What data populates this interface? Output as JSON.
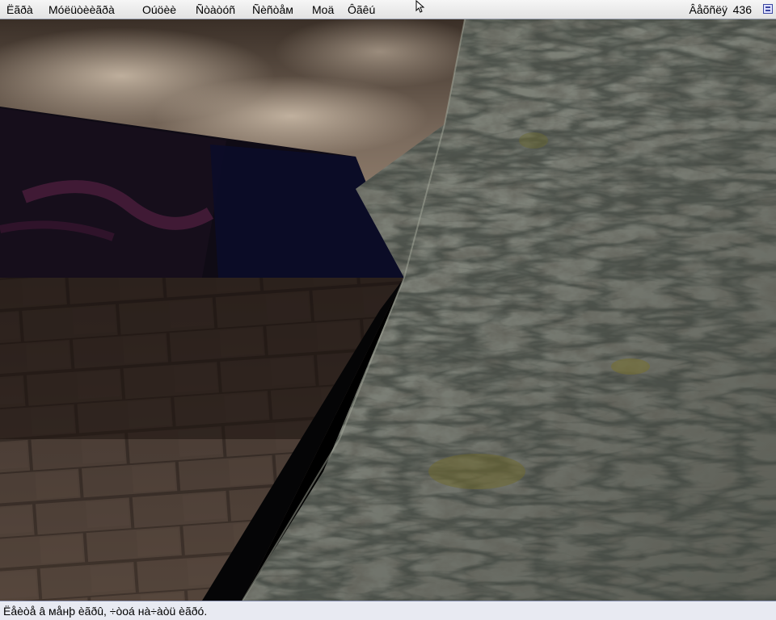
{
  "menu": {
    "items": [
      {
        "label": "Ëãðà"
      },
      {
        "label": "Móëüòèèãðà"
      },
      {
        "label": "Oúöèè"
      },
      {
        "label": "Ñòàòóñ"
      },
      {
        "label": "Ñèñòåм"
      },
      {
        "label": "Mоä"
      },
      {
        "label": "Ôãêú"
      }
    ],
    "vertex_label": "Âåõñëÿ",
    "vertex_value": "436",
    "window_icon": "window-icon"
  },
  "status": {
    "text": "Ëåèòå â мåнþ èãðû, ÷òоá нà÷àòü èãðó."
  },
  "colors": {
    "menubar_bg": "#e6e6e6",
    "statusbar_bg": "#e8eaf2",
    "accent": "#3a45a0"
  }
}
